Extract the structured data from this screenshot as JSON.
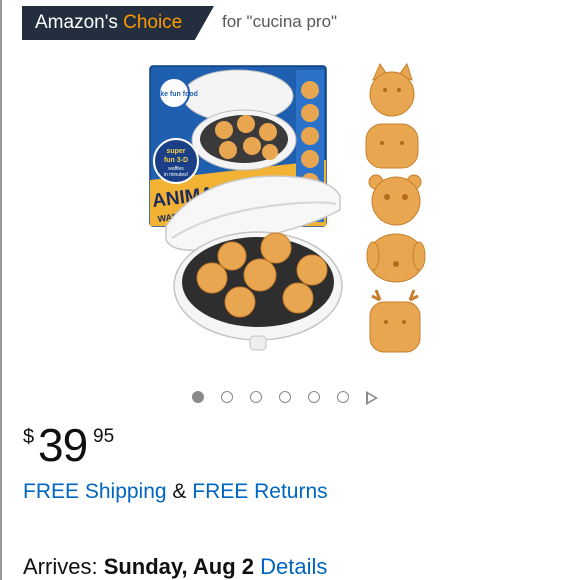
{
  "badge": {
    "brand": "Amazon's",
    "highlight": "Choice",
    "context": "for \"cucina pro\""
  },
  "product_image": {
    "box_logo_text": "make fun food",
    "box_bubble_lines": [
      "super",
      "fun 3-D",
      "waffles",
      "in minutes!"
    ],
    "box_title": "ANIMAL FRIE",
    "box_subtitle": "WAF"
  },
  "carousel": {
    "total_images": 6,
    "active_index": 1
  },
  "price": {
    "symbol": "$",
    "whole": "39",
    "fraction": "95"
  },
  "shipping": {
    "free_shipping": "FREE Shipping",
    "separator": "&",
    "free_returns": "FREE Returns"
  },
  "delivery": {
    "label": "Arrives:",
    "date": "Sunday, Aug 2",
    "details_link": "Details"
  },
  "colors": {
    "badge_bg": "#232f3e",
    "badge_accent": "#ff9900",
    "link": "#0066c0",
    "waffle": "#e9a651",
    "box_blue": "#1f5fb0"
  }
}
